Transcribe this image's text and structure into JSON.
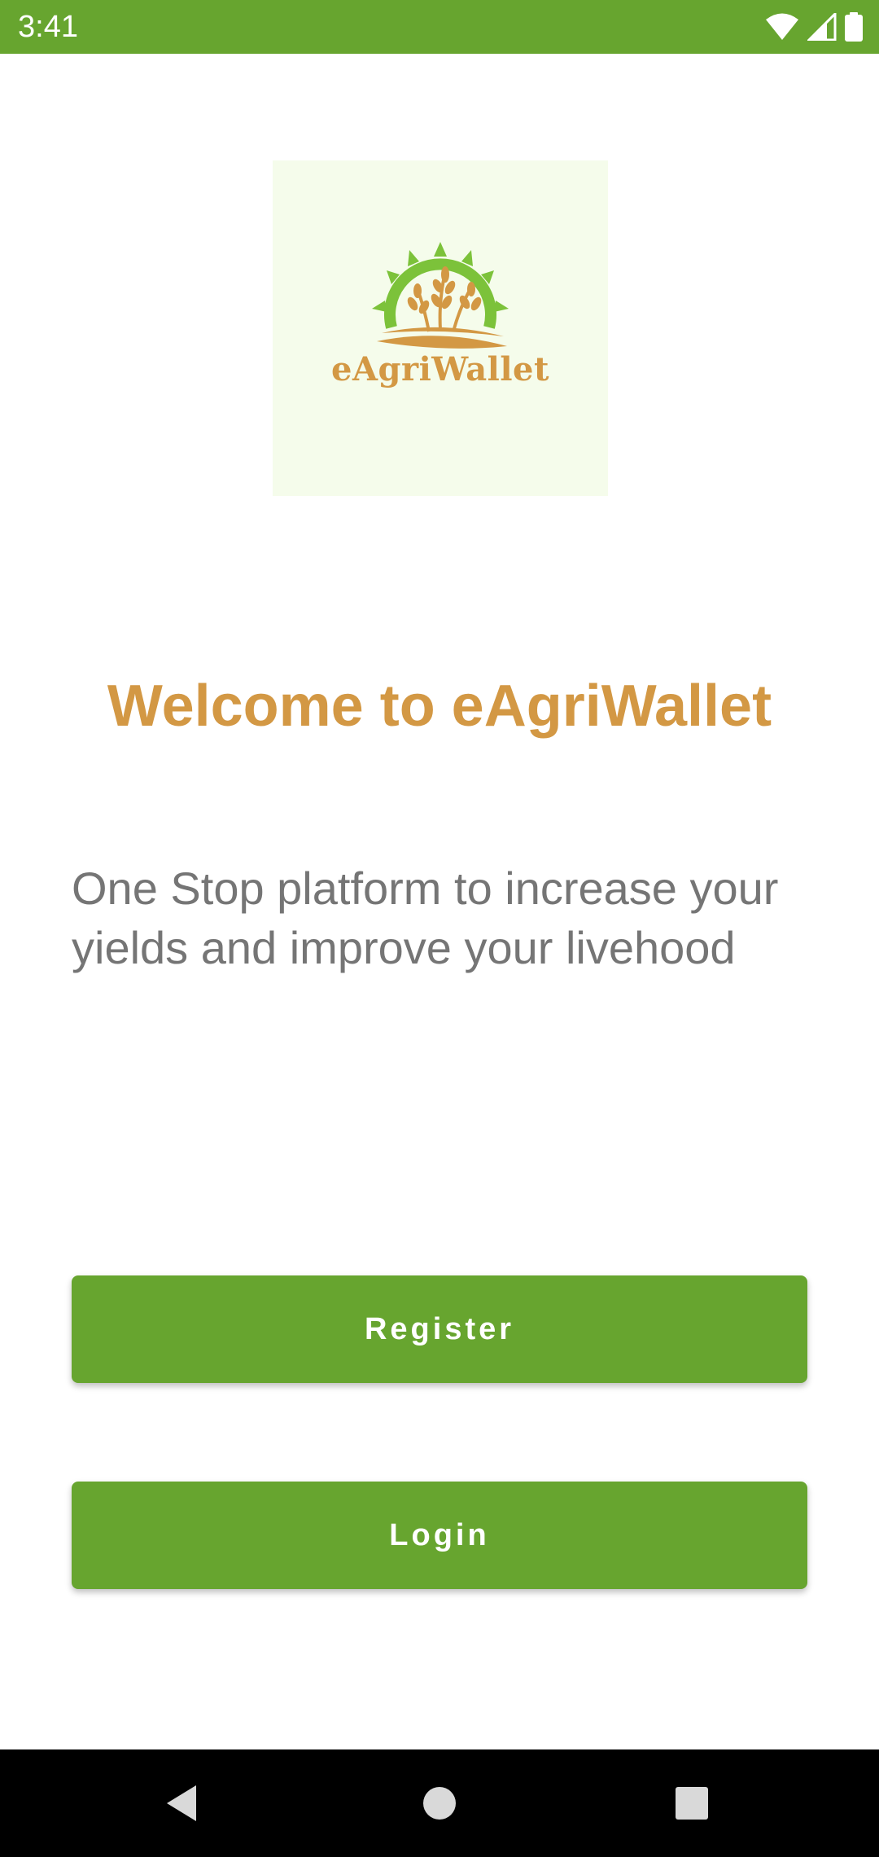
{
  "status_bar": {
    "time": "3:41",
    "background": "#67a52f",
    "icons": [
      "wifi-icon",
      "cellular-signal-icon",
      "battery-icon"
    ]
  },
  "logo": {
    "text": "eAgriWallet",
    "background": "#f5fceb",
    "icons": [
      "sun-icon",
      "wheat-icon"
    ]
  },
  "welcome": {
    "title": "Welcome to eAgriWallet",
    "color": "#d39844"
  },
  "tagline": {
    "text": "One Stop platform to increase your yields and improve your livehood",
    "color": "#757575"
  },
  "buttons": {
    "register_label": "Register",
    "login_label": "Login",
    "color": "#67a52f"
  },
  "nav_bar": {
    "icons": [
      "back-icon",
      "home-icon",
      "recents-icon"
    ]
  }
}
